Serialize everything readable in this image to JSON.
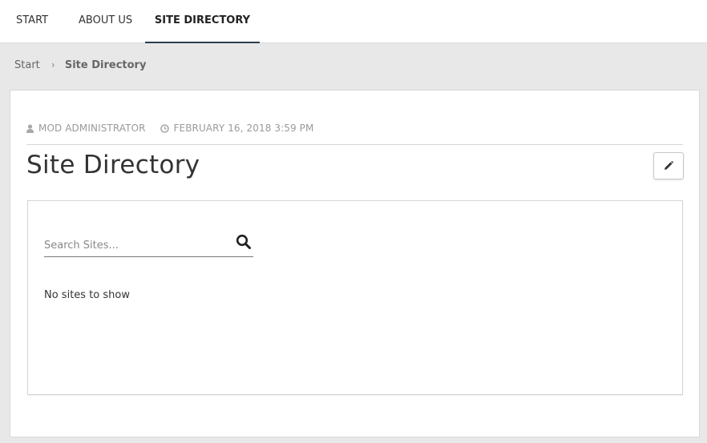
{
  "nav": {
    "tabs": [
      {
        "label": "START",
        "active": false
      },
      {
        "label": "ABOUT US",
        "active": false
      },
      {
        "label": "SITE DIRECTORY",
        "active": true
      }
    ]
  },
  "breadcrumb": {
    "items": [
      "Start",
      "Site Directory"
    ],
    "separator": "›"
  },
  "page": {
    "author": "MOD ADMINISTRATOR",
    "date": "FEBRUARY 16, 2018 3:59 PM",
    "title": "Site Directory",
    "author_icon": "user-icon",
    "date_icon": "clock-icon",
    "edit_icon": "pencil-icon"
  },
  "directory": {
    "search_placeholder": "Search Sites...",
    "search_value": "",
    "search_icon": "search-icon",
    "empty_message": "No sites to show"
  },
  "colors": {
    "active_tab_underline": "#2c3e50",
    "page_background": "#e8e8e8",
    "meta_text": "#9a9a9a"
  }
}
